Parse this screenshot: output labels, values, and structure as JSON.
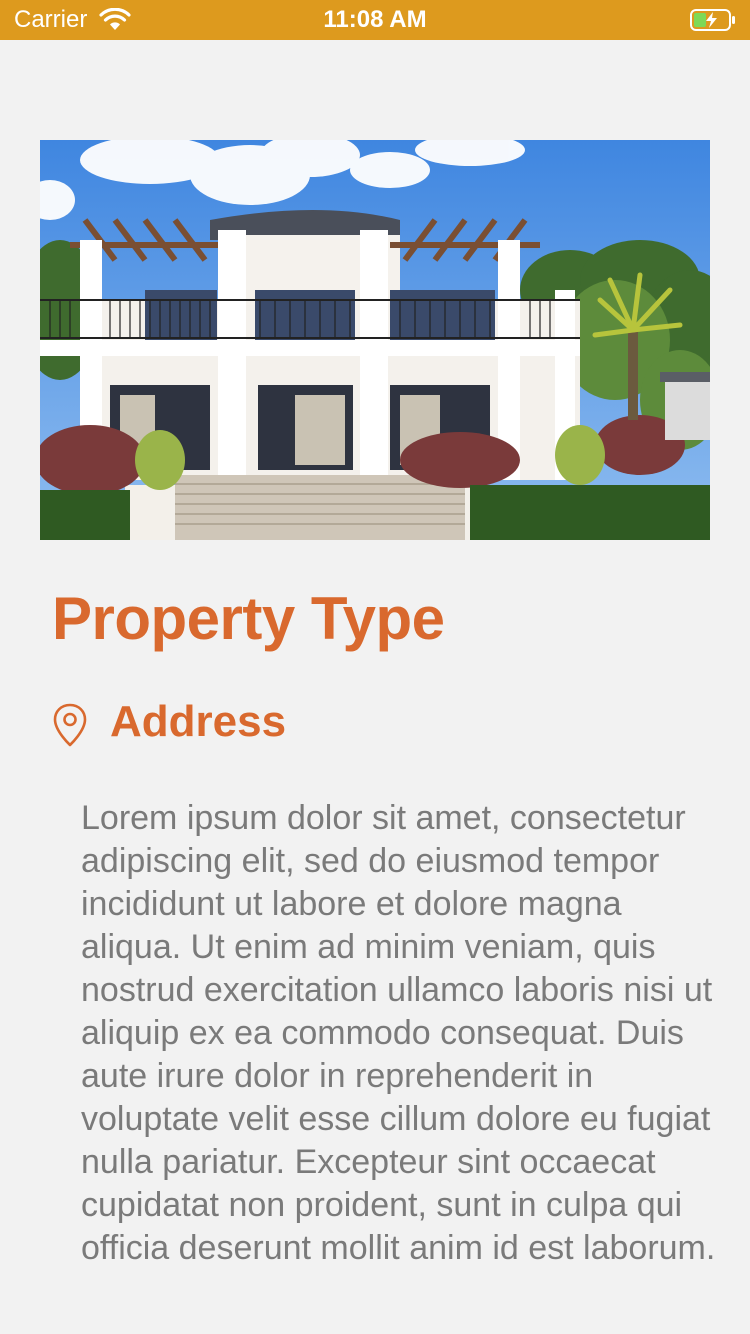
{
  "status_bar": {
    "carrier": "Carrier",
    "time": "11:08 AM",
    "background_color": "#dd9a1e",
    "icons": [
      "wifi-icon",
      "battery-charging-icon"
    ]
  },
  "hero_image": {
    "subject": "Two-story white house with pergolas, front staircase and garden"
  },
  "property": {
    "title": "Property Type",
    "address_icon": "location-pin-icon",
    "address": "Address",
    "description": "Lorem ipsum dolor sit amet, consectetur adipiscing elit, sed do eiusmod tempor incididunt ut labore et dolore magna aliqua. Ut enim ad minim veniam, quis nostrud exercitation ullamco laboris nisi ut aliquip ex ea commodo consequat. Duis aute irure dolor in reprehenderit in voluptate velit esse cillum dolore eu fugiat nulla pariatur. Excepteur sint occaecat cupidatat non proident, sunt in culpa qui officia deserunt mollit anim id est laborum."
  },
  "colors": {
    "accent": "#d9692e",
    "body_text": "#7a7a7a",
    "background": "#f2f2f2"
  }
}
